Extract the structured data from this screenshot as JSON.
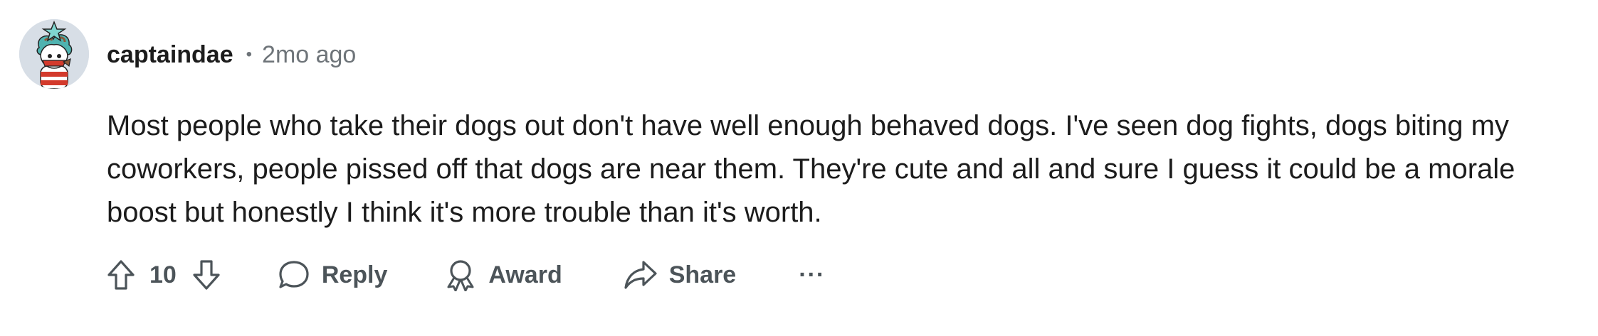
{
  "comment": {
    "username": "captaindae",
    "separator": "•",
    "timestamp": "2mo ago",
    "body": "Most people who take their dogs out don't have well enough behaved dogs. I've seen dog fights, dogs biting my coworkers, people pissed off that dogs are near them. They're cute and all and sure I guess it could be a morale boost but honestly I think it's more trouble than it's worth."
  },
  "actions": {
    "vote_count": "10",
    "reply_label": "Reply",
    "award_label": "Award",
    "share_label": "Share",
    "more_label": "···"
  },
  "icons": {
    "upvote": "arrow-up-outline",
    "downvote": "arrow-down-outline",
    "reply": "speech-bubble",
    "award": "award-ribbon",
    "share": "share-arrow",
    "more": "ellipsis"
  },
  "colors": {
    "text_primary": "#1c1c1c",
    "text_secondary": "#6e7479",
    "action_text": "#4c5459",
    "avatar_bg": "#d7dee6"
  }
}
